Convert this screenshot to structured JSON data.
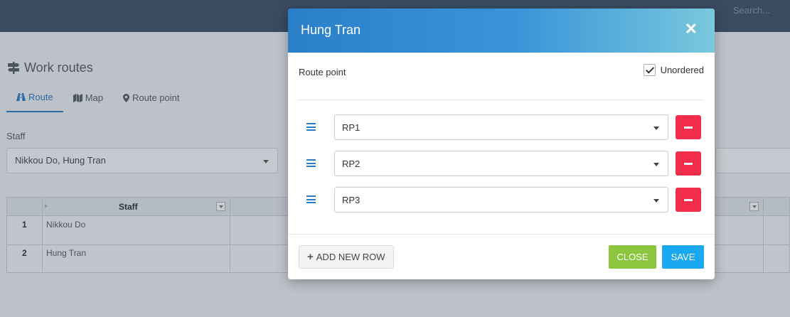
{
  "background": {
    "search_placeholder": "Search...",
    "page_title": "Work routes",
    "tabs": [
      {
        "label": "Route",
        "icon": "road-icon",
        "active": true
      },
      {
        "label": "Map",
        "icon": "map-icon",
        "active": false
      },
      {
        "label": "Route point",
        "icon": "map-marker-icon",
        "active": false
      }
    ],
    "staff_label": "Staff",
    "staff_value": "Nikkou Do, Hung Tran",
    "grid": {
      "header_staff": "Staff",
      "rows": [
        {
          "num": "1",
          "staff": "Nikkou Do"
        },
        {
          "num": "2",
          "staff": "Hung Tran"
        }
      ]
    }
  },
  "modal": {
    "title": "Hung Tran",
    "route_point_label": "Route point",
    "unordered_label": "Unordered",
    "unordered_checked": true,
    "route_points": [
      "RP1",
      "RP2",
      "RP3"
    ],
    "add_row_label": "ADD NEW ROW",
    "close_label": "CLOSE",
    "save_label": "SAVE"
  },
  "colors": {
    "header_gradient_start": "#2a7fc9",
    "header_gradient_end": "#79c8dd",
    "delete_red": "#f22d4b",
    "close_green": "#8cc63f",
    "save_blue": "#1aa8f0"
  }
}
